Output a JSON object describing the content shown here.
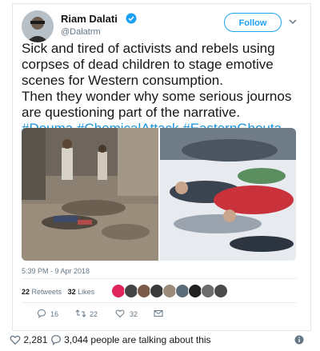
{
  "tweet": {
    "author_name": "Riam Dalati",
    "author_handle": "@Dalatrm",
    "follow_label": "Follow",
    "text_lines": [
      "Sick and tired of activists and rebels using",
      "corpses of dead children to stage emotive",
      "scenes for Western consumption.",
      "Then they wonder why some serious journos",
      "are questioning part of the narrative."
    ],
    "hashtags": "#Douma #ChemicalAttack #EasternGhouta",
    "timestamp": "5:39 PM - 9 Apr 2018",
    "retweets_count": "22",
    "retweets_label": "Retweets",
    "likes_count": "32",
    "likes_label": "Likes",
    "actions": {
      "reply_count": "16",
      "retweet_count": "22",
      "like_count": "32"
    }
  },
  "footer": {
    "likes": "2,281",
    "talking": "3,044 people are talking about this"
  },
  "colors": {
    "accent": "#1da1f2",
    "hashtag": "#1b95e0",
    "muted": "#657786"
  }
}
